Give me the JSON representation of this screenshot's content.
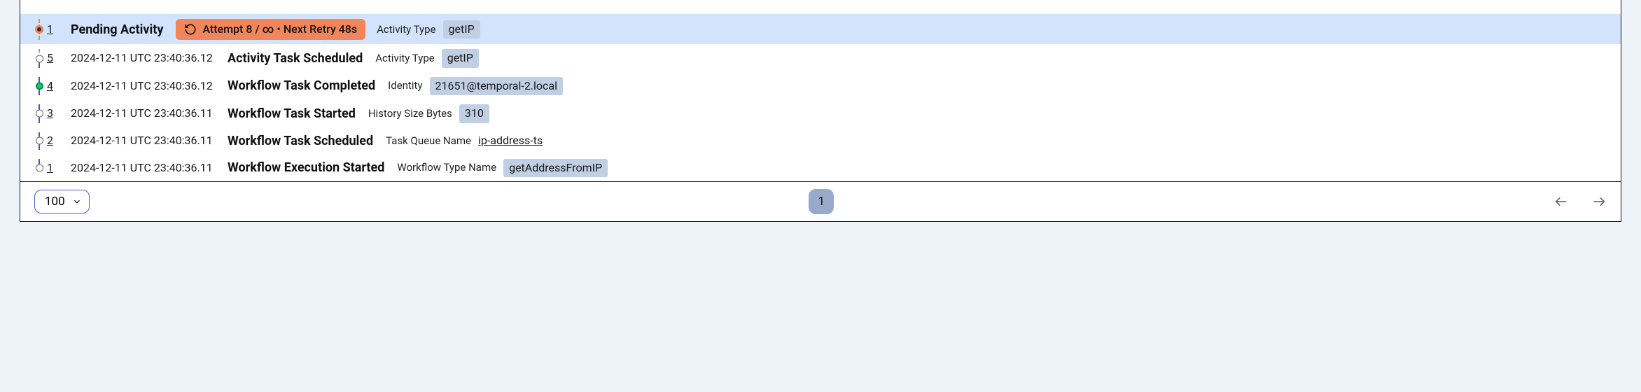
{
  "rows": [
    {
      "seq": "1",
      "title": "Pending Activity",
      "retry": {
        "text": "Attempt 8 / ∞ • Next Retry 48s"
      },
      "attr": {
        "label": "Activity Type",
        "value": "getIP",
        "style": "badge"
      }
    },
    {
      "seq": "5",
      "ts": "2024-12-11 UTC 23:40:36.12",
      "title": "Activity Task Scheduled",
      "attr": {
        "label": "Activity Type",
        "value": "getIP",
        "style": "badge"
      }
    },
    {
      "seq": "4",
      "ts": "2024-12-11 UTC 23:40:36.12",
      "title": "Workflow Task Completed",
      "attr": {
        "label": "Identity",
        "value": "21651@temporal-2.local",
        "style": "badge"
      }
    },
    {
      "seq": "3",
      "ts": "2024-12-11 UTC 23:40:36.11",
      "title": "Workflow Task Started",
      "attr": {
        "label": "History Size Bytes",
        "value": "310",
        "style": "badge"
      }
    },
    {
      "seq": "2",
      "ts": "2024-12-11 UTC 23:40:36.11",
      "title": "Workflow Task Scheduled",
      "attr": {
        "label": "Task Queue Name",
        "value": "ip-address-ts",
        "style": "link"
      }
    },
    {
      "seq": "1",
      "ts": "2024-12-11 UTC 23:40:36.11",
      "title": "Workflow Execution Started",
      "attr": {
        "label": "Workflow Type Name",
        "value": "getAddressFromIP",
        "style": "badge"
      }
    }
  ],
  "footer": {
    "page_size": "100",
    "current_page": "1"
  }
}
